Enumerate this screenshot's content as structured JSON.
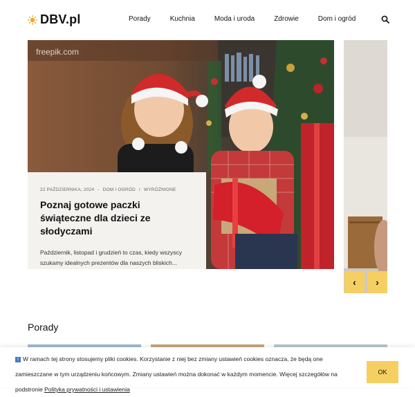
{
  "site": {
    "name": "DBV.pl",
    "accent": "#f5cf62"
  },
  "nav": {
    "items": [
      "Porady",
      "Kuchnia",
      "Moda i uroda",
      "Zdrowie",
      "Dom i ogród"
    ]
  },
  "slider": {
    "watermark": "freepik.com",
    "meta": {
      "date": "22 PAŹDZIERNIKA, 2024",
      "category": "DOM I OGRÓD",
      "tag": "WYRÓŻNIONE"
    },
    "title": "Poznaj gotowe paczki świąteczne dla dzieci ze słodyczami",
    "excerpt": "Październik, listopad i grudzień to czas, kiedy wszyscy szukamy idealnych prezentów dla naszych bliskich...",
    "prev_label": "‹",
    "next_label": "›"
  },
  "section": {
    "title": "Porady"
  },
  "cookie": {
    "text": "W ramach tej strony stosujemy pliki cookies. Korzystanie z niej bez zmiany ustawień cookies oznacza, że będą one zamieszczane w tym urządzeniu końcowym. Zmiany ustawień można dokonać w każdym momencie. Więcej szczegółów na podstronie ",
    "link": "Polityka prywatności i ustawienia",
    "ok_label": "OK",
    "info_glyph": "i"
  }
}
